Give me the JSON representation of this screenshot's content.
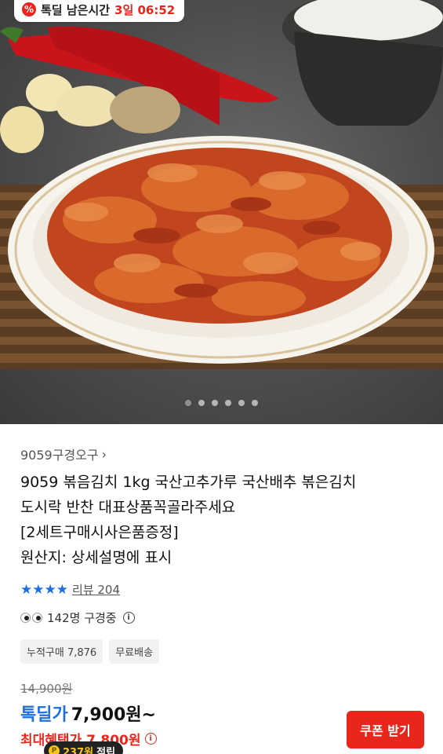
{
  "deal_badge": {
    "icon": "percent-icon",
    "label": "톡딜 남은시간",
    "remaining": "3일 06:52"
  },
  "carousel": {
    "total": 6,
    "active_index": 0
  },
  "product": {
    "seller": "9059구경오구",
    "title_lines": [
      "9059 볶음김치 1kg 국산고추가루 국산배추 볶은김치",
      "도시락 반찬 대표상품꼭골라주세요",
      "[2세트구매시사은품증정]",
      "원산지: 상세설명에 표시"
    ],
    "rating_stars": 4,
    "review_label": "리뷰 204",
    "viewers_label": "142명 구경중",
    "tags": [
      "누적구매 7,876",
      "무료배송"
    ],
    "original_price": "14,900원",
    "deal_label": "톡딜가",
    "deal_price": "7,900원~",
    "max_benefit": "최대혜택가 7,800원",
    "points_label": "237원",
    "points_suffix": "적립"
  },
  "buttons": {
    "coupon": "쿠폰 받기"
  },
  "colors": {
    "brand_red": "#e8261b",
    "deal_blue": "#1e6fe0"
  }
}
